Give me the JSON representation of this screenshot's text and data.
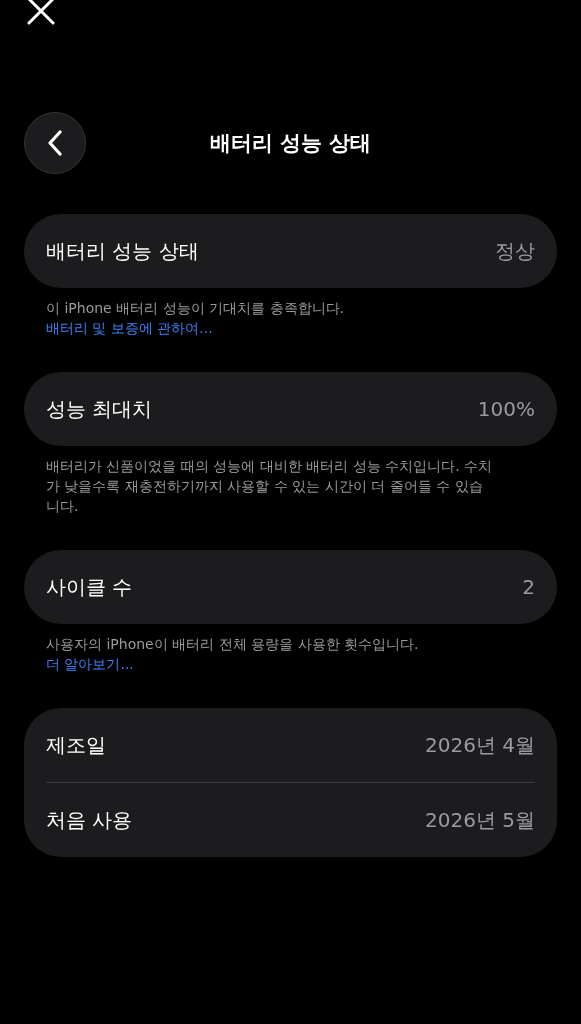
{
  "nav": {
    "title": "배터리 성능 상태"
  },
  "sections": [
    {
      "rows": [
        {
          "label": "배터리 성능 상태",
          "value": "정상"
        }
      ],
      "footnote": {
        "text": "이 iPhone 배터리 성능이 기대치를 충족합니다.",
        "link": "배터리 및 보증에 관하여..."
      }
    },
    {
      "rows": [
        {
          "label": "성능 최대치",
          "value": "100%"
        }
      ],
      "footnote": {
        "text": "배터리가 신품이었을 때의 성능에 대비한 배터리 성능 수치입니다. 수치가 낮을수록 재충전하기까지 사용할 수 있는 시간이 더 줄어들 수 있습니다."
      }
    },
    {
      "rows": [
        {
          "label": "사이클 수",
          "value": "2"
        }
      ],
      "footnote": {
        "text": "사용자의 iPhone이 배터리 전체 용량을 사용한 횟수입니다.",
        "link": "더 알아보기..."
      }
    },
    {
      "rows": [
        {
          "label": "제조일",
          "value": "2026년 4월"
        },
        {
          "label": "처음 사용",
          "value": "2026년 5월"
        }
      ]
    }
  ]
}
